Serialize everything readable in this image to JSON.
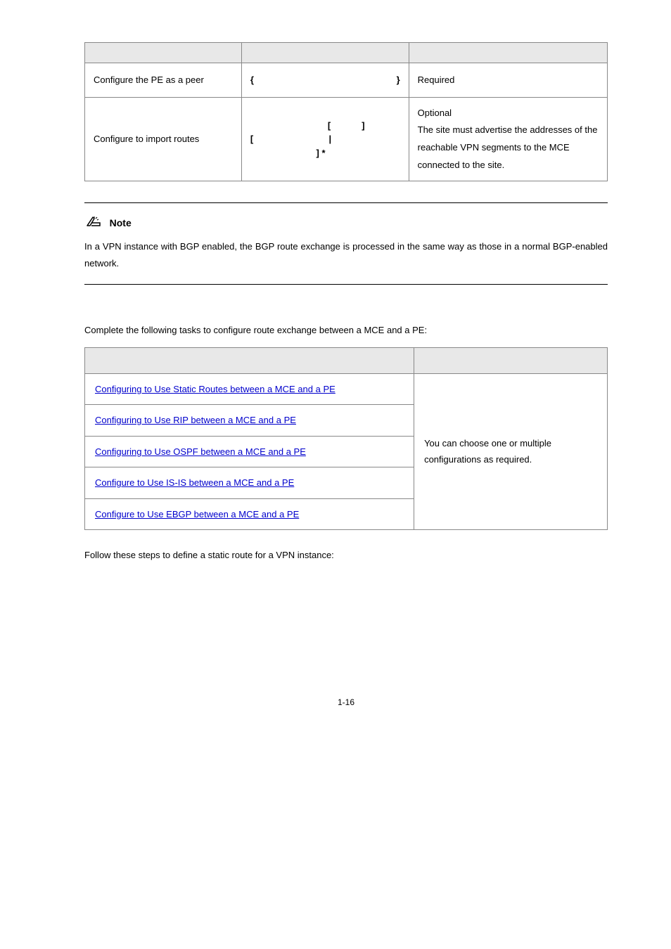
{
  "table1": {
    "headers": [
      "",
      "",
      ""
    ],
    "rows": [
      {
        "c1": "Configure the PE as a peer",
        "c2_pre": "{",
        "c2_post": "}",
        "c3": "Required"
      },
      {
        "c1": "Configure to import routes",
        "c2_a_open": "[",
        "c2_a_close": "]",
        "c2_b_open": "[",
        "c2_b_pipe": "|",
        "c2_b_close": "] *",
        "c3_l1": "Optional",
        "c3_l2": "The site must advertise the addresses of the reachable VPN segments to the MCE connected to the site."
      }
    ]
  },
  "note": {
    "label": "Note",
    "text": "In a VPN instance with BGP enabled, the BGP route exchange is processed in the same way as those in a normal BGP-enabled network."
  },
  "para_intro": "Complete the following tasks to configure route exchange between a MCE and a PE:",
  "table2": {
    "headers": [
      "",
      ""
    ],
    "rows": [
      {
        "link": "Configuring to Use Static Routes between a MCE and a PE"
      },
      {
        "link": "Configuring to Use RIP between a MCE and a PE"
      },
      {
        "link": "Configuring to Use OSPF between a MCE and a PE"
      },
      {
        "link": "Configure to Use IS-IS between a MCE and a PE"
      },
      {
        "link": "Configure to Use EBGP between a MCE and a PE"
      }
    ],
    "right_text": "You can choose one or multiple configurations as required."
  },
  "follow_steps": "Follow these steps to define a static route for a VPN instance:",
  "page": "1-16"
}
